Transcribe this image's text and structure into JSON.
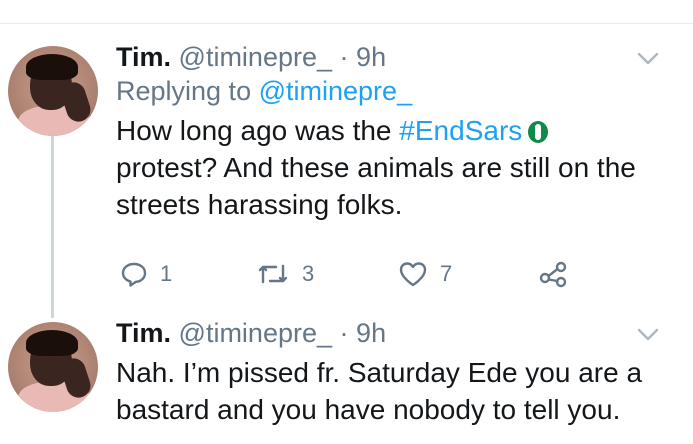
{
  "tweets": [
    {
      "name": "Tim.",
      "handle": "@timinepre_",
      "separator": "·",
      "time": "9h",
      "reply_prefix": "Replying to",
      "reply_mention": "@timinepre_",
      "body_before": "How long ago was the",
      "hashtag": "#EndSars",
      "body_after": "protest? And these animals are still on the streets harassing folks.",
      "hashtag_emoji": "nigeria-flag-emoji",
      "actions": {
        "reply_count": "1",
        "retweet_count": "3",
        "like_count": "7"
      }
    },
    {
      "name": "Tim.",
      "handle": "@timinepre_",
      "separator": "·",
      "time": "9h",
      "body": "Nah. I’m pissed fr. Saturday Ede you are a bastard and you have nobody to tell you."
    }
  ],
  "colors": {
    "link": "#1da1f2",
    "secondary_text": "#657786",
    "primary_text": "#14171a",
    "thread_line": "#ccd6dd"
  },
  "icons": [
    "chevron-down-icon",
    "reply-icon",
    "retweet-icon",
    "like-icon",
    "share-icon"
  ]
}
